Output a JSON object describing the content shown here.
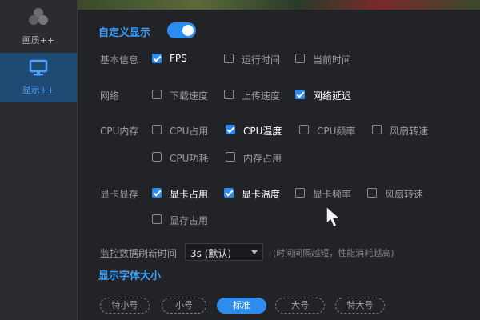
{
  "sidebar": {
    "items": [
      {
        "label": "画质++",
        "icon": "quality-circles-icon",
        "active": false
      },
      {
        "label": "显示++",
        "icon": "monitor-icon",
        "active": true
      }
    ]
  },
  "custom_display": {
    "label": "自定义显示",
    "enabled": true
  },
  "basic_info": {
    "label": "基本信息",
    "options": [
      {
        "label": "FPS",
        "checked": true
      },
      {
        "label": "运行时间",
        "checked": false
      },
      {
        "label": "当前时间",
        "checked": false
      }
    ]
  },
  "network": {
    "label": "网络",
    "options": [
      {
        "label": "下载速度",
        "checked": false
      },
      {
        "label": "上传速度",
        "checked": false
      },
      {
        "label": "网络延迟",
        "checked": true
      }
    ]
  },
  "cpu_memory": {
    "label": "CPU内存",
    "options": [
      {
        "label": "CPU占用",
        "checked": false
      },
      {
        "label": "CPU温度",
        "checked": true
      },
      {
        "label": "CPU频率",
        "checked": false
      },
      {
        "label": "风扇转速",
        "checked": false
      },
      {
        "label": "CPU功耗",
        "checked": false
      },
      {
        "label": "内存占用",
        "checked": false
      }
    ]
  },
  "gpu_memory": {
    "label": "显卡显存",
    "options": [
      {
        "label": "显卡占用",
        "checked": true
      },
      {
        "label": "显卡温度",
        "checked": true
      },
      {
        "label": "显卡频率",
        "checked": false
      },
      {
        "label": "风扇转速",
        "checked": false
      },
      {
        "label": "显存占用",
        "checked": false
      }
    ]
  },
  "refresh": {
    "label": "监控数据刷新时间",
    "value": "3s (默认)",
    "hint": "(时间间隔越短，性能消耗越高)"
  },
  "font_size": {
    "title": "显示字体大小",
    "options": [
      "特小号",
      "小号",
      "标准",
      "大号",
      "特大号"
    ],
    "selected": "标准"
  },
  "colors": {
    "accent": "#2d8cf0",
    "title": "#3aa0ff",
    "sidebar_active_bg": "#1f4a73"
  }
}
